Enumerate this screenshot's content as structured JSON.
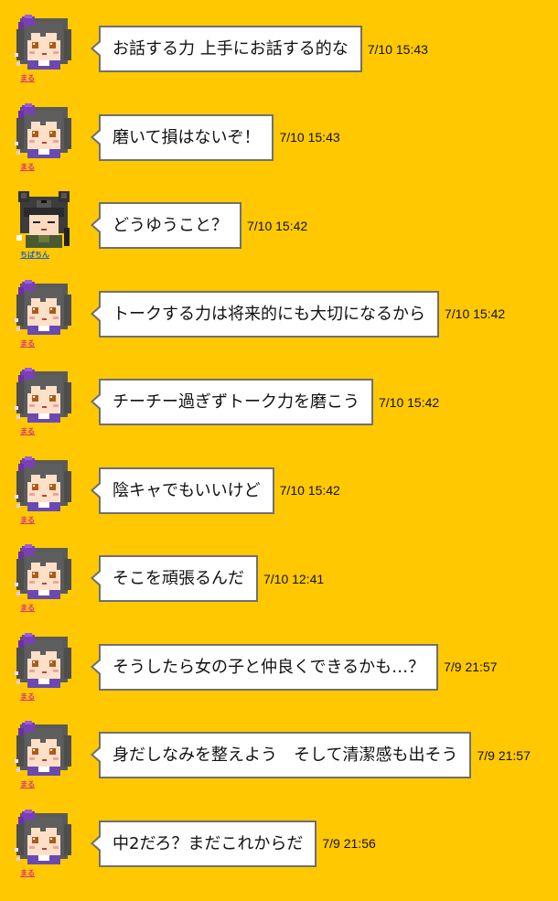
{
  "colors": {
    "background": "#FFC800",
    "bubble_border": "#707070",
    "username_pink": "#E0307A",
    "username_blue": "#2060C0"
  },
  "messages": [
    {
      "user": "まる",
      "avatar": "purple-hair-girl-icon",
      "text": "お話する力 上手にお話する的な",
      "time": "7/10 15:43"
    },
    {
      "user": "まる",
      "avatar": "purple-hair-girl-icon",
      "text": "磨いて損はないぞ！",
      "time": "7/10 15:43"
    },
    {
      "user": "ちばちん",
      "avatar": "bear-hood-boy-icon",
      "text": "どうゆうこと？",
      "time": "7/10 15:42"
    },
    {
      "user": "まる",
      "avatar": "purple-hair-girl-icon",
      "text": "トークする力は将来的にも大切になるから",
      "time": "7/10 15:42"
    },
    {
      "user": "まる",
      "avatar": "purple-hair-girl-icon",
      "text": "チーチー過ぎずトーク力を磨こう",
      "time": "7/10 15:42"
    },
    {
      "user": "まる",
      "avatar": "purple-hair-girl-icon",
      "text": "陰キャでもいいけど",
      "time": "7/10 15:42"
    },
    {
      "user": "まる",
      "avatar": "purple-hair-girl-icon",
      "text": "そこを頑張るんだ",
      "time": "7/10 12:41"
    },
    {
      "user": "まる",
      "avatar": "purple-hair-girl-icon",
      "text": "そうしたら女の子と仲良くできるかも…？",
      "time": "7/9 21:57"
    },
    {
      "user": "まる",
      "avatar": "purple-hair-girl-icon",
      "text": "身だしなみを整えよう　そして清潔感も出そう",
      "time": "7/9 21:57"
    },
    {
      "user": "まる",
      "avatar": "purple-hair-girl-icon",
      "text": "中2だろ？まだこれからだ",
      "time": "7/9 21:56"
    }
  ]
}
